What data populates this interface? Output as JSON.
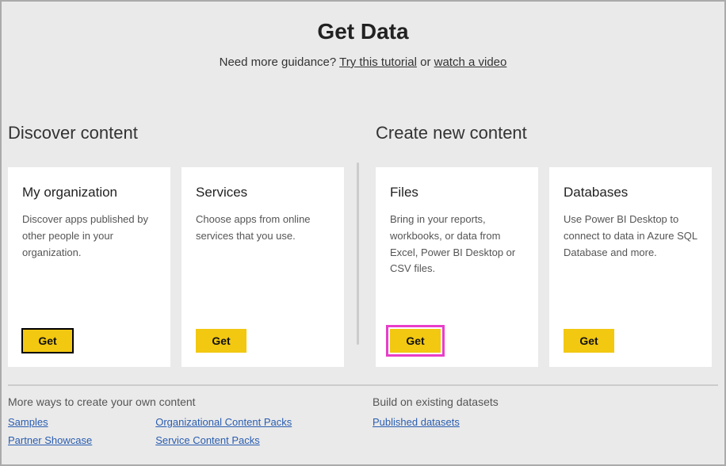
{
  "header": {
    "title": "Get Data",
    "subtitle_prefix": "Need more guidance? ",
    "tutorial_link": "Try this tutorial",
    "subtitle_mid": " or ",
    "video_link": "watch a video"
  },
  "sections": {
    "discover": {
      "title": "Discover content",
      "cards": [
        {
          "title": "My organization",
          "desc": "Discover apps published by other people in your organization.",
          "button": "Get"
        },
        {
          "title": "Services",
          "desc": "Choose apps from online services that you use.",
          "button": "Get"
        }
      ]
    },
    "create": {
      "title": "Create new content",
      "cards": [
        {
          "title": "Files",
          "desc": "Bring in your reports, workbooks, or data from Excel, Power BI Desktop or CSV files.",
          "button": "Get"
        },
        {
          "title": "Databases",
          "desc": "Use Power BI Desktop to connect to data in Azure SQL Database and more.",
          "button": "Get"
        }
      ]
    }
  },
  "bottom": {
    "left_heading": "More ways to create your own content",
    "right_heading": "Build on existing datasets",
    "left_links_col1": [
      "Samples",
      "Partner Showcase"
    ],
    "left_links_col2": [
      "Organizational Content Packs",
      "Service Content Packs"
    ],
    "right_links": [
      "Published datasets"
    ]
  }
}
